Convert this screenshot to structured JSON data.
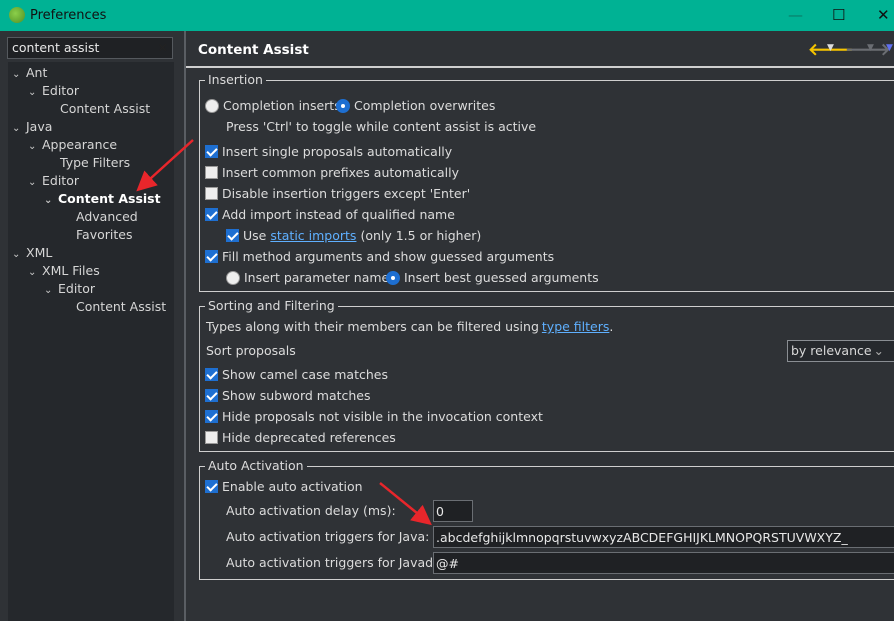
{
  "window": {
    "title": "Preferences",
    "minimize": "—",
    "maximize": "☐",
    "close": "✕"
  },
  "search": {
    "value": "content assist",
    "clear": "✕"
  },
  "tree": [
    {
      "label": "Ant",
      "level": 0,
      "expanded": true
    },
    {
      "label": "Editor",
      "level": 1,
      "expanded": true
    },
    {
      "label": "Content Assist",
      "level": 2
    },
    {
      "label": "Java",
      "level": 0,
      "expanded": true
    },
    {
      "label": "Appearance",
      "level": 1,
      "expanded": true
    },
    {
      "label": "Type Filters",
      "level": 2
    },
    {
      "label": "Editor",
      "level": 1,
      "expanded": true
    },
    {
      "label": "Content Assist",
      "level": 2,
      "expanded": true,
      "selected": true
    },
    {
      "label": "Advanced",
      "level": 3
    },
    {
      "label": "Favorites",
      "level": 3
    },
    {
      "label": "XML",
      "level": 0,
      "expanded": true
    },
    {
      "label": "XML Files",
      "level": 1,
      "expanded": true
    },
    {
      "label": "Editor",
      "level": 2,
      "expanded": true
    },
    {
      "label": "Content Assist",
      "level": 3
    }
  ],
  "page": {
    "title": "Content Assist",
    "back_color": "#f5c400"
  },
  "insertion": {
    "legend": "Insertion",
    "radio_inserts": "Completion inserts",
    "radio_overwrites": "Completion overwrites",
    "overwrites_selected": true,
    "hint": "Press 'Ctrl' to toggle while content assist is active",
    "insert_single": {
      "label": "Insert single proposals automatically",
      "checked": true
    },
    "insert_prefixes": {
      "label": "Insert common prefixes automatically",
      "checked": false
    },
    "disable_triggers": {
      "label": "Disable insertion triggers except 'Enter'",
      "checked": false
    },
    "add_import": {
      "label": "Add import instead of qualified name",
      "checked": true
    },
    "use_static": {
      "prefix": "Use",
      "link": "static imports",
      "suffix": "(only 1.5 or higher)",
      "checked": true
    },
    "fill_args": {
      "label": "Fill method arguments and show guessed arguments",
      "checked": true
    },
    "radio_param_names": "Insert parameter names",
    "radio_best_guessed": "Insert best guessed arguments",
    "best_guessed_selected": true
  },
  "sorting": {
    "legend": "Sorting and Filtering",
    "desc_prefix": "Types along with their members can be filtered using",
    "desc_link": "type filters",
    "desc_suffix": ".",
    "sort_label": "Sort proposals",
    "sort_value": "by relevance",
    "camel": {
      "label": "Show camel case matches",
      "checked": true
    },
    "subword": {
      "label": "Show subword matches",
      "checked": true
    },
    "hide_invisible": {
      "label": "Hide proposals not visible in the invocation context",
      "checked": true
    },
    "hide_deprecated": {
      "label": "Hide deprecated references",
      "checked": false
    }
  },
  "auto": {
    "legend": "Auto Activation",
    "enable": {
      "label": "Enable auto activation",
      "checked": true
    },
    "delay_label": "Auto activation delay (ms):",
    "delay_value": "0",
    "java_label": "Auto activation triggers for Java:",
    "java_value": ".abcdefghijklmnopqrstuvwxyzABCDEFGHIJKLMNOPQRSTUVWXYZ_",
    "javadoc_label": "Auto activation triggers for Javadoc:",
    "javadoc_value": "@#"
  }
}
